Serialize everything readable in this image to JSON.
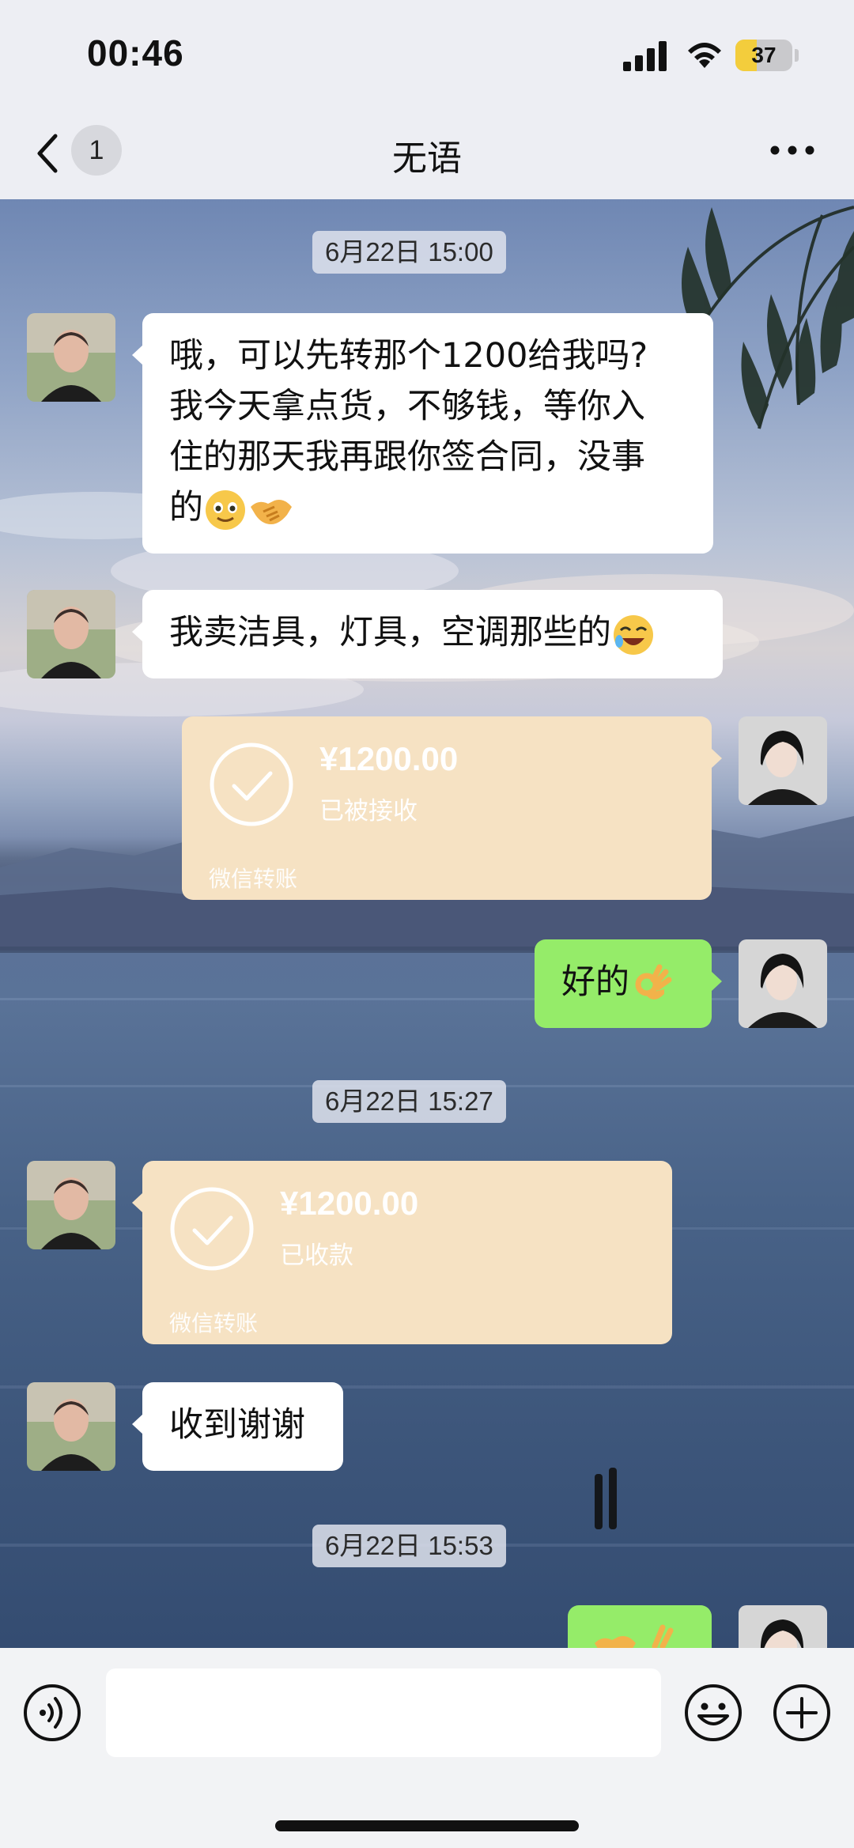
{
  "status_bar": {
    "time": "00:46",
    "battery_level": "37",
    "battery_fraction": 0.37,
    "icons": [
      "signal-icon",
      "wifi-icon",
      "battery-icon"
    ]
  },
  "header": {
    "unread_count": "1",
    "title": "无语",
    "icons": [
      "chevron-left-icon",
      "more-icon"
    ]
  },
  "messages": [
    {
      "type": "timestamp",
      "text": "6月22日 15:00"
    },
    {
      "type": "text",
      "side": "left",
      "lines": [
        "哦，可以先转那个1200给我吗?",
        "我今天拿点货，不够钱，等你入",
        "住的那天我再跟你签合同，没事",
        "的"
      ],
      "emoji": [
        "slightly-smiling-face-emoji",
        "handshake-emoji"
      ]
    },
    {
      "type": "text",
      "side": "left",
      "text": "我卖洁具，灯具，空调那些的",
      "emoji": [
        "rolling-on-floor-laughing-emoji"
      ]
    },
    {
      "type": "transfer",
      "side": "right",
      "amount": "¥1200.00",
      "status": "已被接收",
      "footer": "微信转账"
    },
    {
      "type": "text",
      "side": "right",
      "text": "好的",
      "emoji": [
        "ok-hand-emoji"
      ]
    },
    {
      "type": "timestamp",
      "text": "6月22日 15:27"
    },
    {
      "type": "transfer",
      "side": "left",
      "amount": "¥1200.00",
      "status": "已收款",
      "footer": "微信转账"
    },
    {
      "type": "text",
      "side": "left",
      "text": "收到谢谢"
    },
    {
      "type": "timestamp",
      "text": "6月22日 15:53"
    },
    {
      "type": "partial",
      "side": "right",
      "emoji": [
        "handshake-emoji",
        "ok-hand-emoji"
      ]
    }
  ],
  "input_bar": {
    "value": "",
    "placeholder": "",
    "icons": [
      "voice-icon",
      "emoji-icon",
      "plus-icon"
    ]
  },
  "colors": {
    "sent_bubble": "#95ec69",
    "received_bubble": "#ffffff",
    "transfer_card": "#f6e2c3",
    "battery_fill": "#f3cd3c"
  }
}
